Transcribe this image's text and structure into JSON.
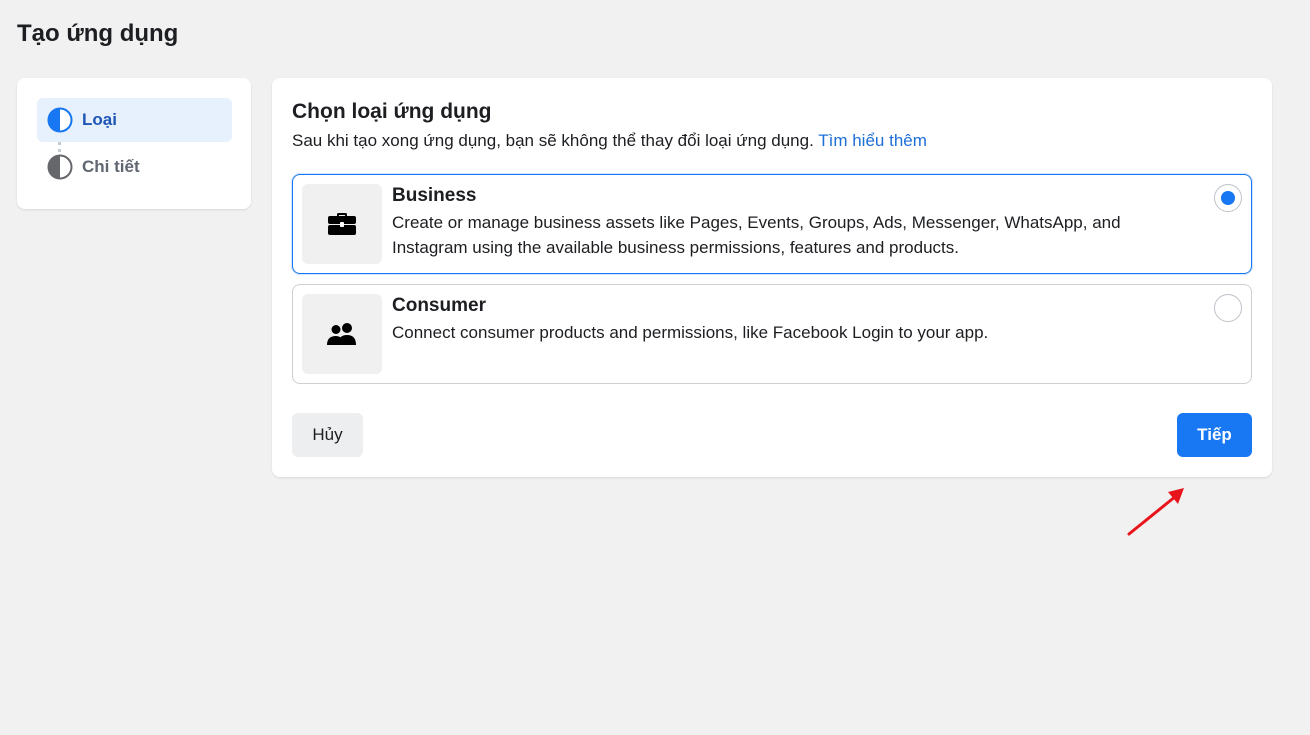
{
  "page": {
    "title": "Tạo ứng dụng"
  },
  "steps": [
    {
      "label": "Loại",
      "state": "active",
      "icon": "half-circle-icon"
    },
    {
      "label": "Chi tiết",
      "state": "inactive",
      "icon": "half-circle-icon"
    }
  ],
  "main": {
    "title": "Chọn loại ứng dụng",
    "subtitle": "Sau khi tạo xong ứng dụng, bạn sẽ không thể thay đổi loại ứng dụng.",
    "learn_more": "Tìm hiểu thêm",
    "options": [
      {
        "title": "Business",
        "description": "Create or manage business assets like Pages, Events, Groups, Ads, Messenger, WhatsApp, and Instagram using the available business permissions, features and products.",
        "icon": "briefcase-icon",
        "selected": true
      },
      {
        "title": "Consumer",
        "description": "Connect consumer products and permissions, like Facebook Login to your app.",
        "icon": "people-icon",
        "selected": false
      }
    ],
    "cancel_label": "Hủy",
    "next_label": "Tiếp"
  },
  "colors": {
    "accent": "#1877f2",
    "link": "#1d6fd8",
    "active_step_bg": "#e7f0fd",
    "annotation_arrow": "#e8141b"
  }
}
